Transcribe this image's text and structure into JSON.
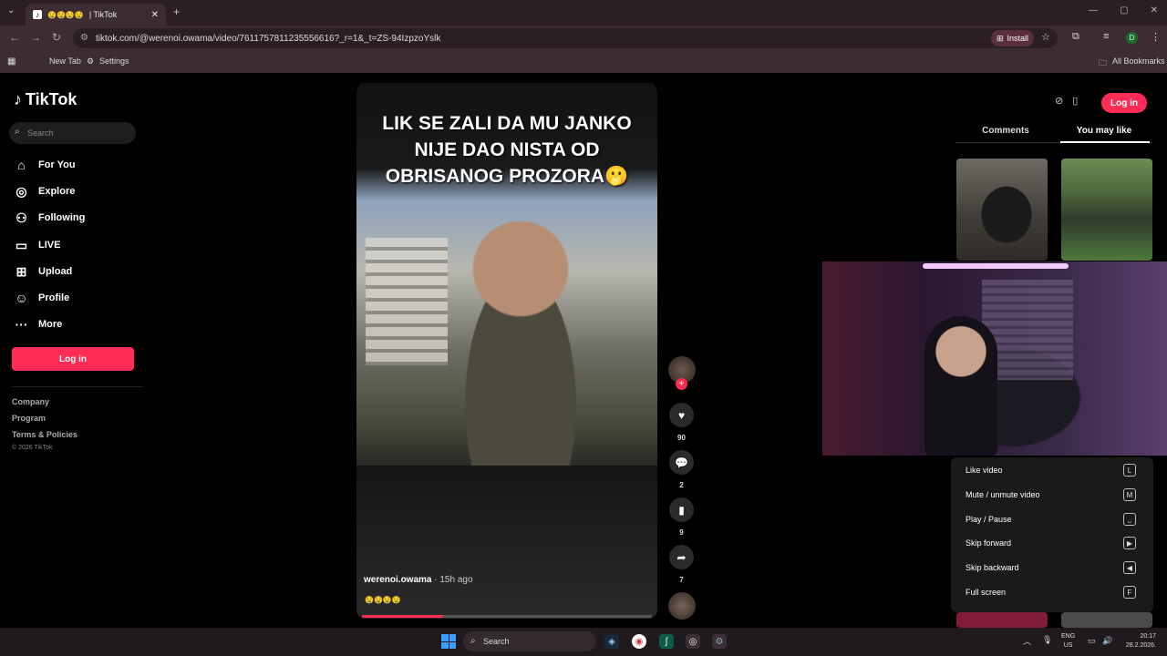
{
  "browser": {
    "tab_title": "| TikTok",
    "new_tab_symbol": "+",
    "url": "tiktok.com/@werenoi.owama/video/7611757811235556616?_r=1&_t=ZS-94IzpzoYslk",
    "install_label": "Install",
    "bookmarks": [
      {
        "label": "New Tab"
      },
      {
        "label": "Settings"
      }
    ],
    "all_bookmarks_label": "All Bookmarks",
    "profile_initial": "D"
  },
  "tiktok": {
    "logo": "TikTok",
    "search_placeholder": "Search",
    "nav": [
      {
        "label": "For You",
        "icon": "home-icon"
      },
      {
        "label": "Explore",
        "icon": "compass-icon"
      },
      {
        "label": "Following",
        "icon": "following-icon"
      },
      {
        "label": "LIVE",
        "icon": "live-icon"
      },
      {
        "label": "Upload",
        "icon": "upload-icon"
      },
      {
        "label": "Profile",
        "icon": "profile-icon"
      },
      {
        "label": "More",
        "icon": "more-icon"
      }
    ],
    "login_label": "Log in",
    "footer": {
      "company": "Company",
      "program": "Program",
      "terms": "Terms & Policies",
      "copyright": "© 2026 TikTok"
    }
  },
  "video": {
    "caption": "LIK SE ZALI DA MU JANKO NIJE DAO NISTA OD OBRISANOG PROZORA🫢",
    "author": "werenoi.owama",
    "time": " · 15h ago",
    "emojis": "🤤🤤🤤🤤",
    "progress": 0.28,
    "likes": "90",
    "comments": "2",
    "saves": "9",
    "shares": "7"
  },
  "panel": {
    "login_label": "Log in",
    "tabs": [
      "Comments",
      "You may like"
    ],
    "active_tab": "You may like"
  },
  "shortcuts": [
    {
      "label": "Like video",
      "key": "L"
    },
    {
      "label": "Mute / unmute video",
      "key": "M"
    },
    {
      "label": "Play / Pause",
      "key": "⎵"
    },
    {
      "label": "Skip forward",
      "key": "▶"
    },
    {
      "label": "Skip backward",
      "key": "◀"
    },
    {
      "label": "Full screen",
      "key": "F"
    }
  ],
  "taskbar": {
    "search_label": "Search",
    "lang_top": "ENG",
    "lang_bottom": "US",
    "time": "20:17",
    "date": "28.2.2026."
  },
  "colors": {
    "accent": "#fe2c55",
    "browser_frame": "#3c2c33"
  }
}
